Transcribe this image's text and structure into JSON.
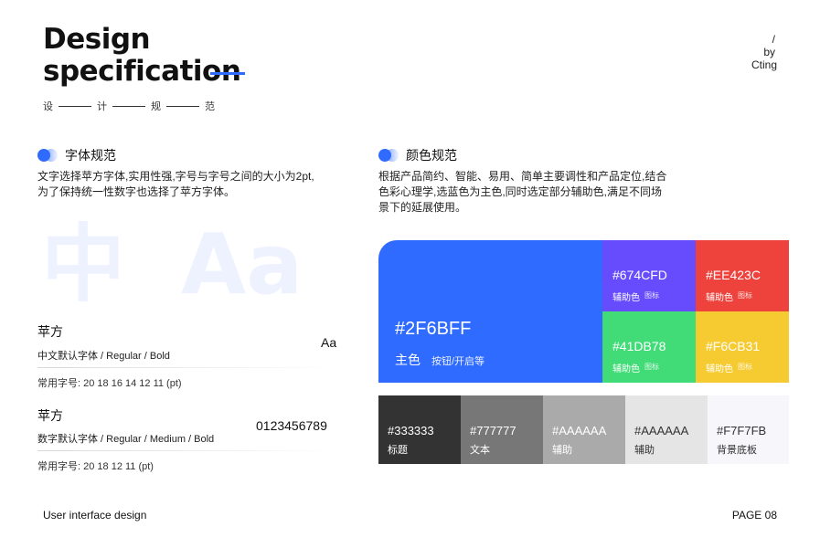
{
  "header": {
    "title_line1": "Design",
    "title_line2": "specification",
    "subtitle_chars": [
      "设",
      "计",
      "规",
      "范"
    ],
    "slash": "/",
    "by": "by",
    "author": "Cting"
  },
  "font_section": {
    "heading": "字体规范",
    "description_line1": "文字选择苹方字体,实用性强,字号与字号之间的大小为2pt,",
    "description_line2": "为了保持统一性数字也选择了苹方字体。",
    "big_glyph_cn": "中",
    "big_glyph_latin": "Aa",
    "fonts": [
      {
        "name": "苹方",
        "desc": "中文默认字体 / Regular / Bold",
        "sample": "Aa",
        "sizes": "常用字号:  20   18   16   14   12   11   (pt)"
      },
      {
        "name": "苹方",
        "desc": "数字默认字体 / Regular / Medium / Bold",
        "sample": "0123456789",
        "sizes": "常用字号:  20   18   12   11   (pt)"
      }
    ]
  },
  "color_section": {
    "heading": "颜色规范",
    "description_line1": "根据产品简约、智能、易用、简单主要调性和产品定位,结合",
    "description_line2": "色彩心理学,选蓝色为主色,同时选定部分辅助色,满足不同场",
    "description_line3": "景下的延展使用。",
    "main": {
      "hex": "#2F6BFF",
      "label": "主色",
      "sub": "按钮/开启等",
      "color": "#2F6BFF"
    },
    "accents": [
      {
        "hex": "#674CFD",
        "label": "辅助色",
        "sub": "图标",
        "color": "#674CFD"
      },
      {
        "hex": "#EE423C",
        "label": "辅助色",
        "sub": "图标",
        "color": "#EE423C"
      },
      {
        "hex": "#41DB78",
        "label": "辅助色",
        "sub": "图标",
        "color": "#41DB78"
      },
      {
        "hex": "#F6CB31",
        "label": "辅助色",
        "sub": "图标",
        "color": "#F6CB31"
      }
    ],
    "grays": [
      {
        "hex": "#333333",
        "label": "标题",
        "color": "#333333",
        "text_color": "#ffffff"
      },
      {
        "hex": "#777777",
        "label": "文本",
        "color": "#777777",
        "text_color": "#ffffff"
      },
      {
        "hex": "#AAAAAA",
        "label": "辅助",
        "color": "#AAAAAA",
        "text_color": "#ffffff"
      },
      {
        "hex": "#AAAAAA",
        "label": "辅助",
        "color": "#E5E5E5",
        "text_color": "#333333"
      },
      {
        "hex": "#F7F7FB",
        "label": "背景底板",
        "color": "#F7F7FB",
        "text_color": "#333333"
      }
    ]
  },
  "footer": {
    "left": "User interface design",
    "right": "PAGE 08"
  }
}
